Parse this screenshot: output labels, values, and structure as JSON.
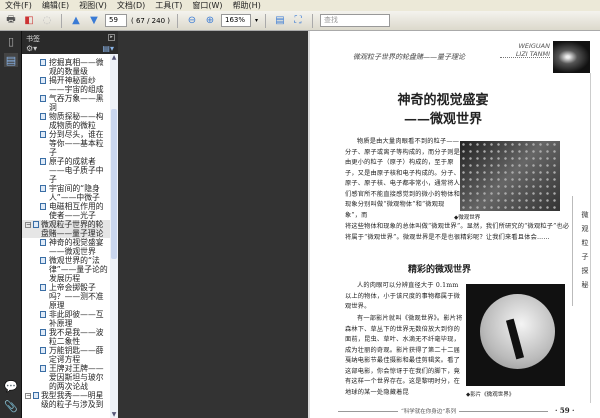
{
  "menu": [
    "文件(F)",
    "编辑(E)",
    "视图(V)",
    "文档(D)",
    "工具(T)",
    "窗口(W)",
    "帮助(H)"
  ],
  "toolbar": {
    "page_number": "59",
    "page_count": "( 67 / 240 )",
    "zoom": "163%",
    "search_placeholder": "查找"
  },
  "bookmarks": {
    "title": "书签",
    "items": [
      {
        "label": "挖掘真相——微观的数量级",
        "level": 2
      },
      {
        "label": "揭开神秘面纱——宇宙的组成",
        "level": 2
      },
      {
        "label": "气吞万象——黑洞",
        "level": 2
      },
      {
        "label": "物质探秘——构成物质的微粒",
        "level": 2
      },
      {
        "label": "分到尽头，谁在等你——基本粒子",
        "level": 2
      },
      {
        "label": "原子的成就者——电子质子中子",
        "level": 2
      },
      {
        "label": "宇宙间的“隐身人”——中微子",
        "level": 2
      },
      {
        "label": "电磁相互作用的使者——光子",
        "level": 2
      },
      {
        "label": "微观粒子世界的轮盘赌——量子理论",
        "level": 1,
        "selected": true
      },
      {
        "label": "神奇的视觉盛宴——微观世界",
        "level": 2
      },
      {
        "label": "微观世界的“法律”——量子论的发展历程",
        "level": 2
      },
      {
        "label": "上帝会掷骰子吗？——测不准原理",
        "level": 2
      },
      {
        "label": "非此即彼——互补原理",
        "level": 2
      },
      {
        "label": "我不是我——波粒二象性",
        "level": 2
      },
      {
        "label": "万能钥匙——薛定谔方程",
        "level": 2
      },
      {
        "label": "王牌对王牌——爱因斯坦与玻尔的两次论战",
        "level": 2
      },
      {
        "label": "我型我秀——明星级的粒子与涉及到",
        "level": 1
      }
    ]
  },
  "page": {
    "running_head": "微观粒子世界的轮盘赌——量子理论",
    "series_en_1": "WEIGUAN",
    "series_en_2": "LIZI TANMI",
    "title_1": "神奇的视觉盛宴",
    "title_2": "——微观世界",
    "para1": "物质是由大量肉眼看不到的粒子——分子、原子或离子等构成的，而分子则是由更小的粒子（原子）构成的，至于原子，又是由原子核和电子构成的。分子、原子、原子核、电子都非常小，通常将人们感官所不能直接感觉到的微小的物体和现象分别叫做“微观物体”和“微观现象”，而",
    "para1_cont": "将这些物体和现象的总体叫做“微观世界”。显然，我们所研究的“微观粒子”也必将属于“微观世界”。微观世界是不是也很精彩呢？让我们来看且体会……",
    "caption1": "◆微观世界",
    "subtitle": "精彩的微观世界",
    "para2": "人的肉眼可以分辨直径大于 0.1mm 以上的物体，小于该尺度的事物都属于微观世界。",
    "para3": "有一部影片就叫《微观世界》。影片将森林下、草丛下的世界无数倍放大到你的面前，昆虫、草叶、水滴无不纤毫毕现，成为壮丽的奇观。影片获得了第二十二届戛纳电影节最佳摄影和最佳剪辑奖。看了这部电影，你会惊讶于在我们的脚下，竟有这样一个世界存在。这是黎明时分，在地球的某一处隐藏着昆",
    "caption2": "◆影片《微观世界》",
    "side_tab": "微观粒子探秘",
    "footer": "“科学就在你身边”系列",
    "page_num": "· 59 ·"
  }
}
